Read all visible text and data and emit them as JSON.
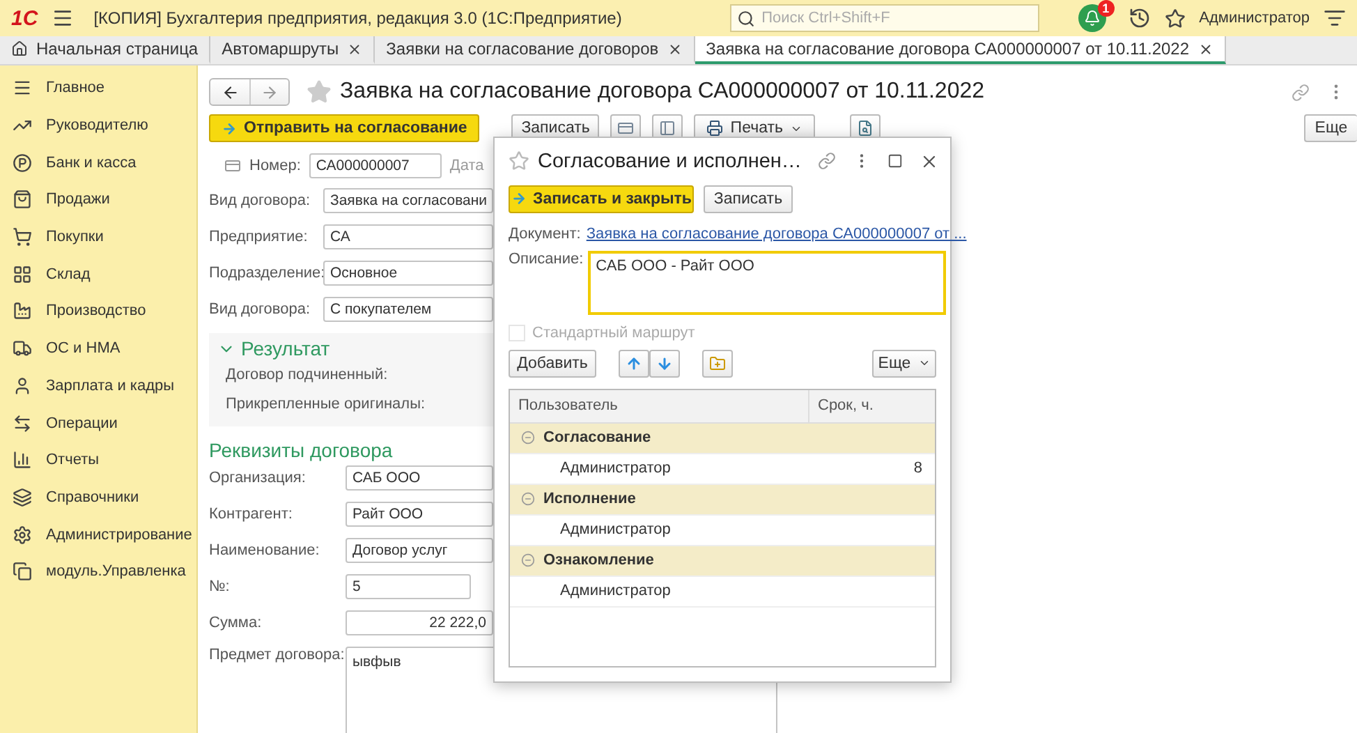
{
  "app": {
    "logo": "1С",
    "title": "[КОПИЯ] Бухгалтерия предприятия, редакция 3.0  (1С:Предприятие)",
    "search": {
      "placeholder": "Поиск Ctrl+Shift+F"
    },
    "notifications": "1",
    "user": "Администратор"
  },
  "tabs": [
    {
      "label": "Начальная страница",
      "kind": "home",
      "selected": false
    },
    {
      "label": "Автомаршруты",
      "kind": "closable",
      "selected": false
    },
    {
      "label": "Заявки на согласование договоров",
      "kind": "closable",
      "selected": false
    },
    {
      "label": "Заявка на согласование договора СА000000007 от 10.11.2022",
      "kind": "closable",
      "selected": true
    }
  ],
  "sidebar": {
    "items": [
      {
        "label": "Главное"
      },
      {
        "label": "Руководителю"
      },
      {
        "label": "Банк и касса"
      },
      {
        "label": "Продажи"
      },
      {
        "label": "Покупки"
      },
      {
        "label": "Склад"
      },
      {
        "label": "Производство"
      },
      {
        "label": "ОС и НМА"
      },
      {
        "label": "Зарплата и кадры"
      },
      {
        "label": "Операции"
      },
      {
        "label": "Отчеты"
      },
      {
        "label": "Справочники"
      },
      {
        "label": "Администрирование"
      },
      {
        "label": "модуль.Управленка"
      }
    ]
  },
  "form": {
    "title": "Заявка на согласование договора СА000000007 от 10.11.2022",
    "send_button": "Отправить на согласование",
    "save_button": "Записать",
    "print_button": "Печать",
    "more_button": "Еще",
    "number": {
      "label": "Номер:",
      "value": "СА000000007"
    },
    "date_label": "Дата",
    "fields": [
      {
        "label": "Вид договора:",
        "value": "Заявка на согласовани"
      },
      {
        "label": "Предприятие:",
        "value": "СА"
      },
      {
        "label": "Подразделение:",
        "value": "Основное"
      },
      {
        "label": "Вид договора:",
        "value": "С покупателем"
      }
    ],
    "result_group": {
      "title": "Результат",
      "expanded": true,
      "rows": [
        "Договор подчиненный:",
        "Прикрепленные оригиналы:"
      ]
    },
    "details_title": "Реквизиты договора",
    "details": [
      {
        "label": "Организация:",
        "value": "САБ ООО",
        "kind": "field"
      },
      {
        "label": "Контрагент:",
        "value": "Райт ООО",
        "kind": "field"
      },
      {
        "label": "Наименование:",
        "value": "Договор услуг",
        "kind": "field"
      },
      {
        "label": "№:",
        "value": "5",
        "kind": "short"
      },
      {
        "label": "Сумма:",
        "value": "22 222,0",
        "kind": "number"
      },
      {
        "label": "Предмет договора:",
        "value": "ывфыв",
        "kind": "memo"
      }
    ]
  },
  "dialog": {
    "title": "Согласование и исполнен…",
    "save_close_button": "Записать и закрыть",
    "save_button": "Записать",
    "document": {
      "label": "Документ:",
      "link": "Заявка на согласование договора СА000000007 от ..."
    },
    "description": {
      "label": "Описание:",
      "value": "САБ ООО - Райт ООО"
    },
    "standard_route": {
      "label": "Стандартный маршрут",
      "checked": false,
      "disabled": true
    },
    "add_button": "Добавить",
    "more_button": "Еще",
    "table": {
      "columns": [
        "Пользователь",
        "Срок, ч."
      ],
      "rows": [
        {
          "label": "Согласование",
          "expanded": true,
          "children": [
            {
              "user": "Администратор",
              "term": "8"
            }
          ]
        },
        {
          "label": "Исполнение",
          "expanded": true,
          "children": [
            {
              "user": "Администратор"
            }
          ]
        },
        {
          "label": "Ознакомление",
          "expanded": true,
          "children": [
            {
              "user": "Администратор"
            }
          ]
        }
      ]
    }
  }
}
